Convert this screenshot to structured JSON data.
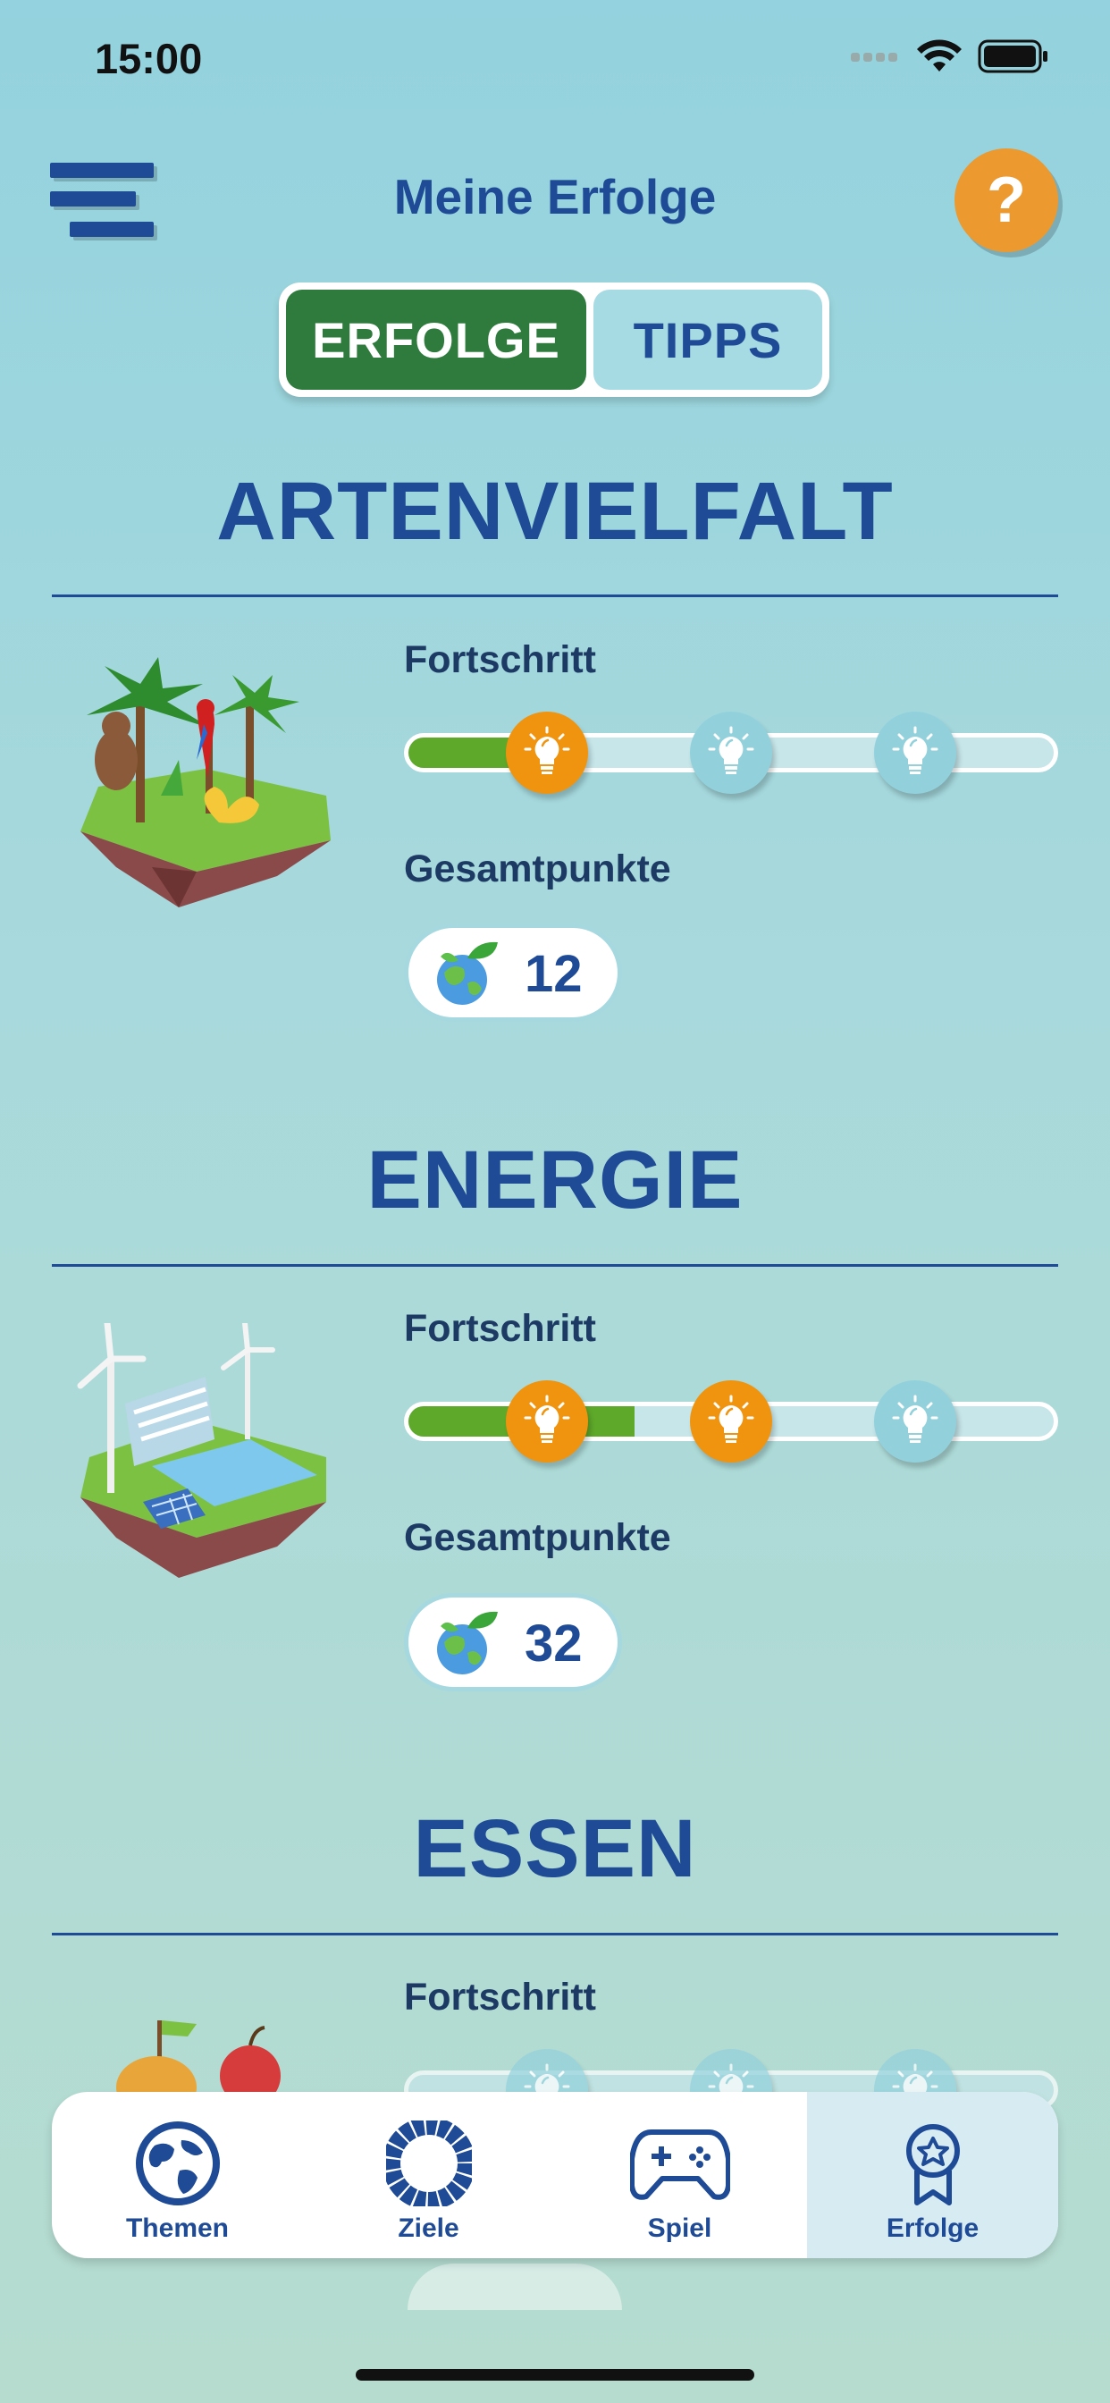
{
  "status_bar": {
    "time": "15:00"
  },
  "header": {
    "title": "Meine Erfolge",
    "menu_icon": "hamburger-menu-icon",
    "help_label": "?"
  },
  "segments": {
    "active": "ERFOLGE",
    "inactive": "TIPPS"
  },
  "colors": {
    "primary": "#1e4a96",
    "active_green": "#2e7b3d",
    "progress_green": "#5ea92a",
    "bulb_on": "#f0940f",
    "bulb_off": "#92d1dc",
    "help": "#ec9930"
  },
  "sections": [
    {
      "title": "ARTENVIELFALT",
      "progress_label": "Fortschritt",
      "points_label": "Gesamtpunkte",
      "points": "12",
      "progress_fraction": 0.17,
      "bulbs_lit": 1
    },
    {
      "title": "ENERGIE",
      "progress_label": "Fortschritt",
      "points_label": "Gesamtpunkte",
      "points": "32",
      "progress_fraction": 0.35,
      "bulbs_lit": 2
    },
    {
      "title": "ESSEN",
      "progress_label": "Fortschritt"
    }
  ],
  "tabbar": [
    {
      "label": "Themen",
      "icon": "globe-icon"
    },
    {
      "label": "Ziele",
      "icon": "sdg-wheel-icon"
    },
    {
      "label": "Spiel",
      "icon": "gamepad-icon"
    },
    {
      "label": "Erfolge",
      "icon": "award-badge-icon",
      "active": true
    }
  ]
}
